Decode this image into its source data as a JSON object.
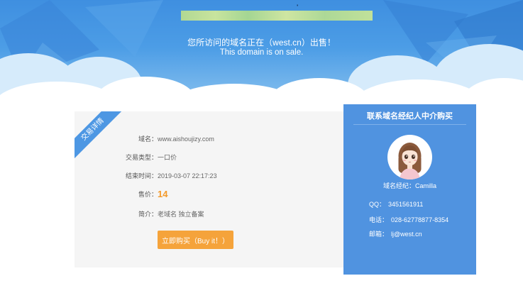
{
  "banner": {
    "headline_cn": "您所访问的域名正在（west.cn）出售！",
    "headline_en": "This domain is on sale."
  },
  "card": {
    "ribbon": "交易详情",
    "rows": [
      {
        "label": "域名：",
        "value": "www.aishoujizy.com"
      },
      {
        "label": "交易类型：",
        "value": "一口价"
      },
      {
        "label": "结束时间：",
        "value": "2019-03-07 22:17:23"
      },
      {
        "label": "售价：",
        "value": "14"
      },
      {
        "label": "简介：",
        "value": "老域名 独立备案"
      }
    ],
    "buy_label": "立即购买（Buy it！）"
  },
  "broker": {
    "title": "联系域名经纪人中介购买",
    "name": "域名经纪：Camilla",
    "qq_label": "QQ：",
    "qq": "3451561911",
    "phone_label": "电话：",
    "phone": "028-62778877-8354",
    "email_label": "邮箱：",
    "email": "lj@west.cn"
  },
  "colors": {
    "accent_blue": "#4d97e3",
    "price_orange": "#f39a2b",
    "button_orange": "#f5a33b"
  }
}
